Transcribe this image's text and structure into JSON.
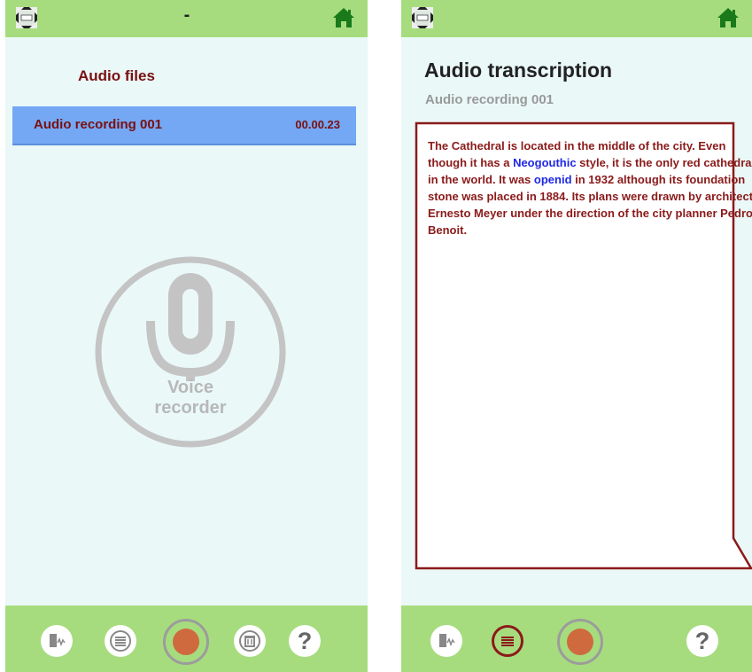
{
  "left_screen": {
    "top_title": "-",
    "section_title": "Audio files",
    "files": [
      {
        "name": "Audio recording 001",
        "duration": "00.00.23"
      }
    ],
    "voice_recorder_label_line1": "Voice",
    "voice_recorder_label_line2": "recorder"
  },
  "right_screen": {
    "title": "Audio transcription",
    "subtitle": "Audio recording 001",
    "transcription": {
      "part1": "The Cathedral is located in the middle of the city. Even though it has a ",
      "kw1": "Neogouthic",
      "part2": " style, it is the only red cathedral in the world. It was ",
      "kw2": "openid",
      "part3": " in 1932 although its foundation stone was placed in 1884. Its plans were drawn by architect Ernesto Meyer under the direction of  the city planner Pedro Benoit."
    }
  },
  "colors": {
    "bar": "#a6dc7e",
    "background": "#eaf8f8",
    "selected_row": "#74a8f4",
    "text_dark_red": "#8b1a1a",
    "keyword_blue": "#1e28e6",
    "record": "#cf6a3f",
    "home_green": "#1a7a1a"
  },
  "icons": {
    "logo": "city-logo-icon",
    "home": "home-icon",
    "voice_file": "voice-file-icon",
    "list": "list-lines-icon",
    "record": "record-icon",
    "delete": "trash-icon",
    "help": "help-icon",
    "microphone": "microphone-icon"
  },
  "help_glyph": "?"
}
